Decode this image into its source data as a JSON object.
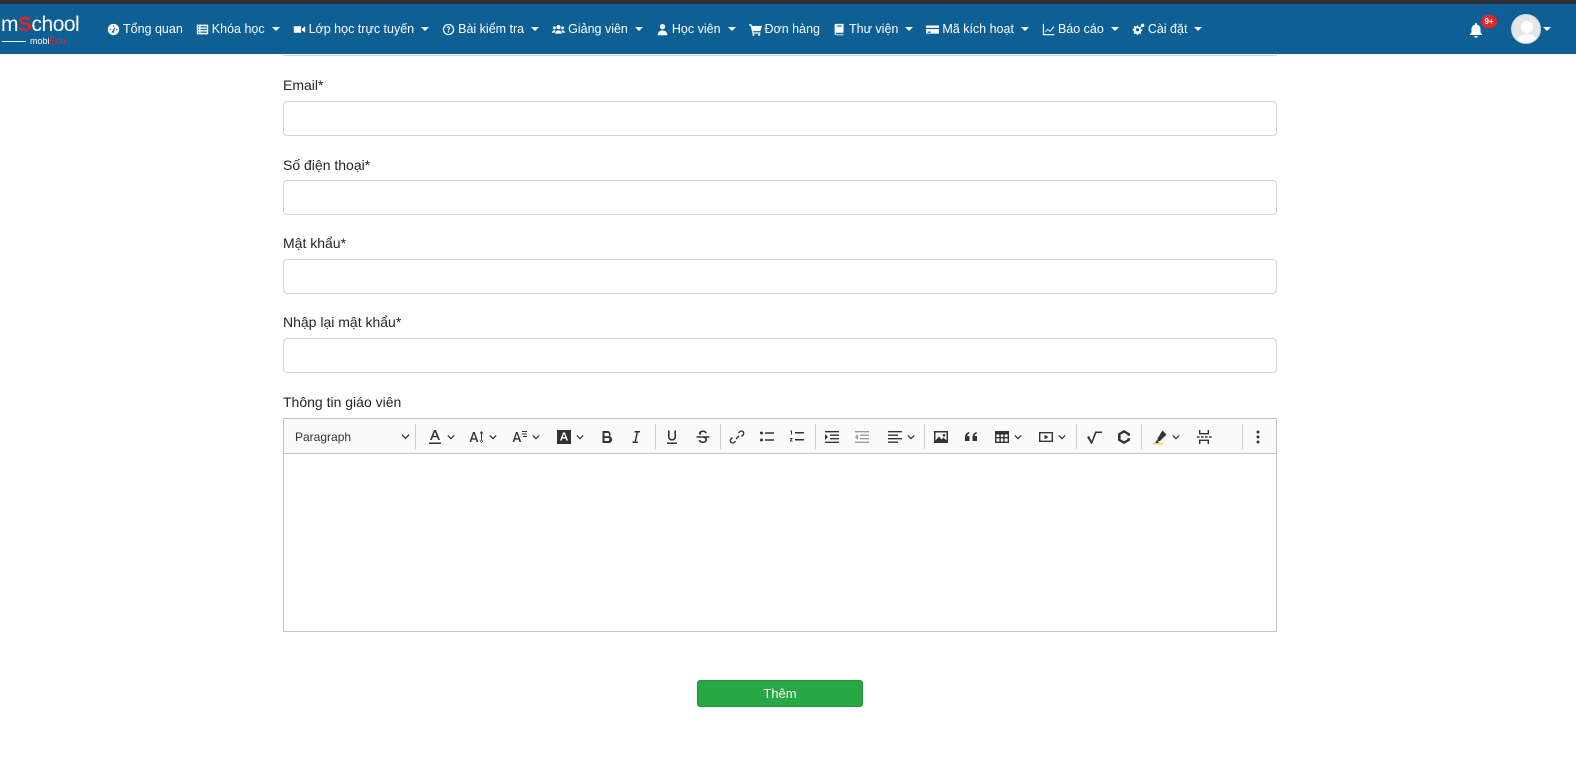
{
  "navbar": {
    "logo_main": "m",
    "logo_s": "S",
    "logo_rest": "chool",
    "logo_sub": "mobi",
    "logo_sub_edu": "Edu",
    "items": [
      {
        "label": "Tổng quan",
        "icon": "dashboard-icon",
        "dropdown": false
      },
      {
        "label": "Khóa học",
        "icon": "list-icon",
        "dropdown": true
      },
      {
        "label": "Lớp học trực tuyến",
        "icon": "video-icon",
        "dropdown": true
      },
      {
        "label": "Bài kiểm tra",
        "icon": "question-circle-icon",
        "dropdown": true
      },
      {
        "label": "Giảng viên",
        "icon": "users-icon",
        "dropdown": true
      },
      {
        "label": "Học viên",
        "icon": "user-icon",
        "dropdown": true
      },
      {
        "label": "Đơn hàng",
        "icon": "cart-icon",
        "dropdown": false
      },
      {
        "label": "Thư viện",
        "icon": "book-icon",
        "dropdown": true
      },
      {
        "label": "Mã kích hoạt",
        "icon": "credit-card-icon",
        "dropdown": true
      },
      {
        "label": "Báo cáo",
        "icon": "line-chart-icon",
        "dropdown": true
      },
      {
        "label": "Cài đặt",
        "icon": "cogs-icon",
        "dropdown": true
      }
    ],
    "notification_badge": "9+"
  },
  "form": {
    "email_label": "Email*",
    "phone_label": "Số điện thoại*",
    "password_label": "Mật khẩu*",
    "confirm_password_label": "Nhập lại mật khẩu*",
    "info_label": "Thông tin giáo viên",
    "email_value": "",
    "phone_value": "",
    "password_value": "",
    "confirm_password_value": ""
  },
  "editor": {
    "paragraph_select": "Paragraph",
    "content": ""
  },
  "submit_label": "Thêm",
  "colors": {
    "navbar": "#0e5f96",
    "accent_red": "#e32227",
    "submit_green": "#28a745"
  }
}
